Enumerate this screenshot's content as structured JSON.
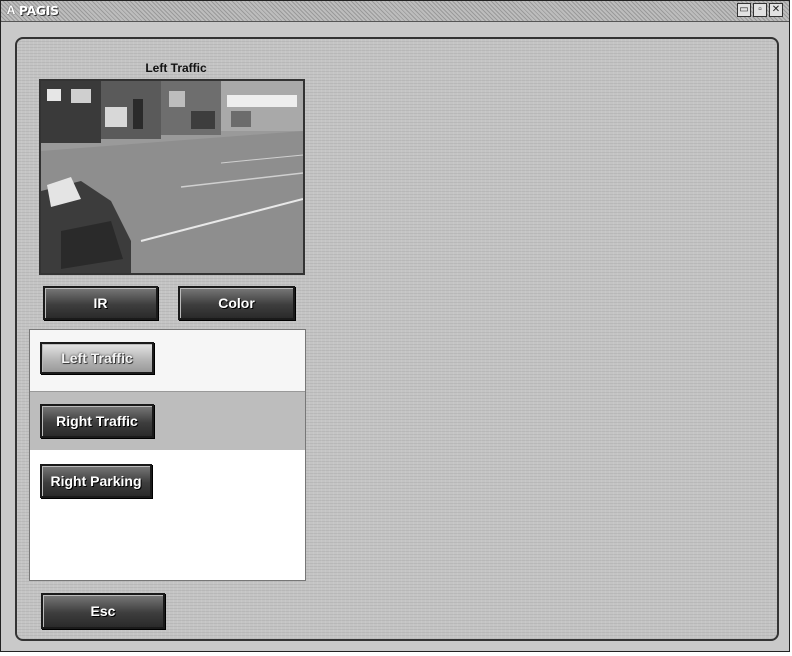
{
  "window": {
    "title": "PAGIS",
    "app_icon": "a-letter-icon",
    "controls": [
      "minimize-icon",
      "restore-icon",
      "close-icon"
    ]
  },
  "camera": {
    "label": "Left Traffic"
  },
  "modes": {
    "ir_label": "IR",
    "color_label": "Color"
  },
  "cameras_list": [
    {
      "label": "Left Traffic",
      "selected": true
    },
    {
      "label": "Right Traffic",
      "selected": false
    },
    {
      "label": "Right Parking",
      "selected": false
    }
  ],
  "esc_label": "Esc"
}
